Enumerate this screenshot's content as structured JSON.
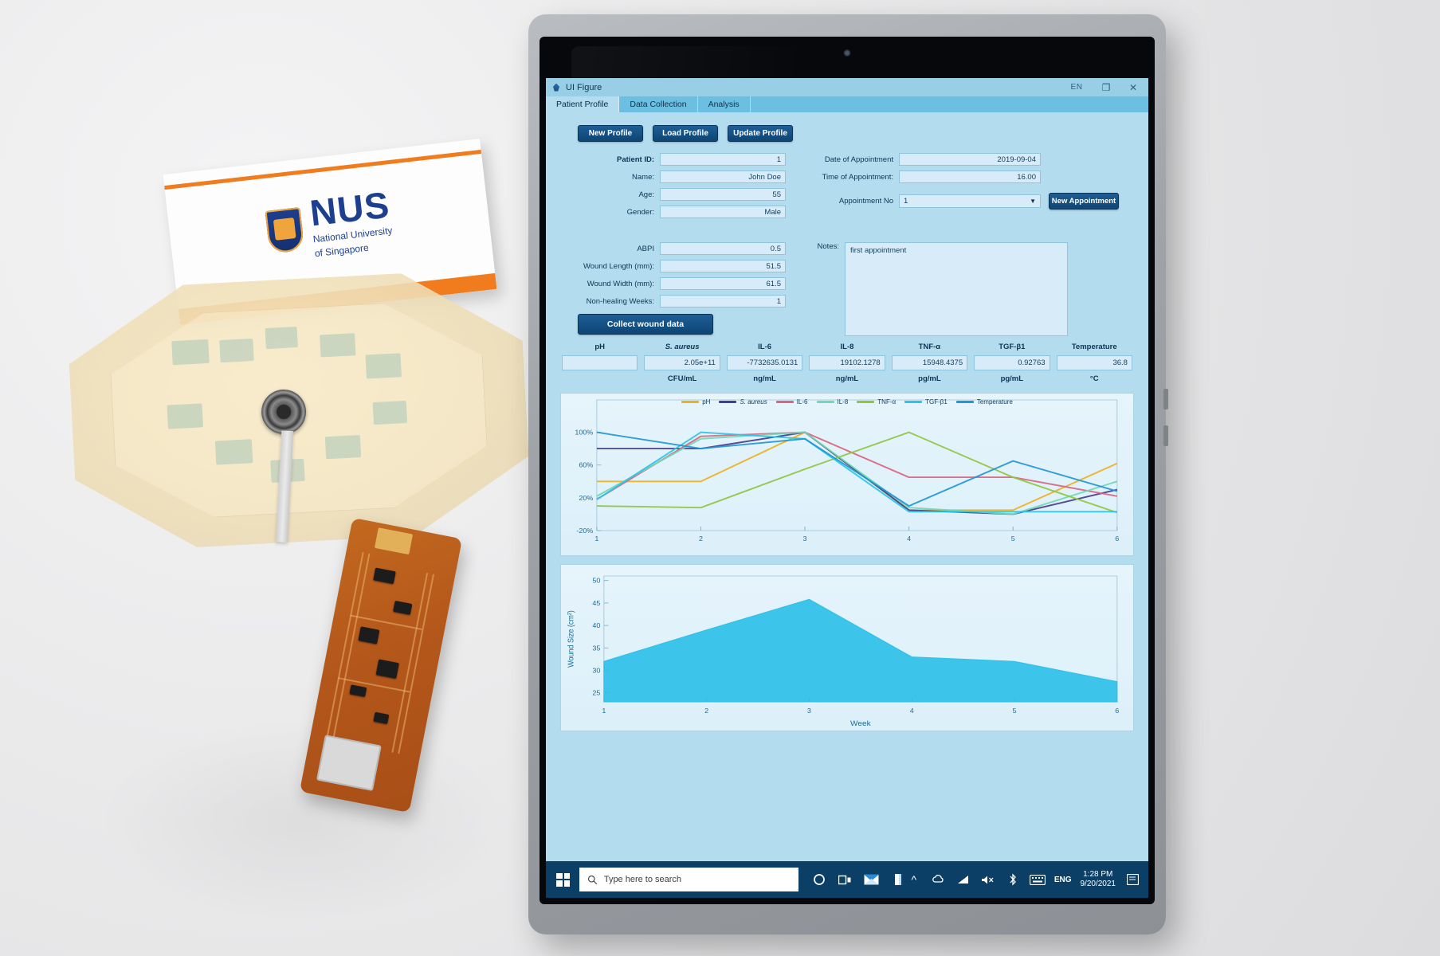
{
  "scene": {
    "business_card": {
      "brand": "NUS",
      "line1": "National University",
      "line2": "of Singapore"
    }
  },
  "window": {
    "title": "UI Figure",
    "title_icon": "matlab-figure-icon",
    "lang_indicator": "EN",
    "controls": {
      "maximize": "❐",
      "close": "✕",
      "lang_caret": "↕"
    },
    "tabs": [
      {
        "label": "Patient Profile",
        "active": true
      },
      {
        "label": "Data Collection",
        "active": false
      },
      {
        "label": "Analysis",
        "active": false
      }
    ]
  },
  "toolbar": {
    "new_profile": "New Profile",
    "load_profile": "Load Profile",
    "update_profile": "Update Profile",
    "new_appointment": "New Appointment",
    "collect_wound_data": "Collect wound data"
  },
  "profile_form": {
    "left": [
      {
        "label": "Patient ID:",
        "value": "1",
        "bold": true
      },
      {
        "label": "Name:",
        "value": "John Doe",
        "bold": false
      },
      {
        "label": "Age:",
        "value": "55",
        "bold": false
      },
      {
        "label": "Gender:",
        "value": "Male",
        "bold": false
      }
    ],
    "right": [
      {
        "label": "Date of Appointment",
        "value": "2019-09-04"
      },
      {
        "label": "Time of Appointment:",
        "value": "16.00"
      }
    ],
    "appointment_no": {
      "label": "Appointment No",
      "value": "1"
    },
    "wound": [
      {
        "label": "ABPI",
        "value": "0.5"
      },
      {
        "label": "Wound Length (mm):",
        "value": "51.5"
      },
      {
        "label": "Wound Width (mm):",
        "value": "61.5"
      },
      {
        "label": "Non-healing Weeks:",
        "value": "1"
      }
    ],
    "notes": {
      "label": "Notes:",
      "value": "first appointment"
    }
  },
  "biomarkers": [
    {
      "name": "pH",
      "italic": false,
      "value": "",
      "unit": ""
    },
    {
      "name": "S. aureus",
      "italic": true,
      "value": "2.05e+11",
      "unit": "CFU/mL"
    },
    {
      "name": "IL-6",
      "italic": false,
      "value": "-7732635.0131",
      "unit": "ng/mL"
    },
    {
      "name": "IL-8",
      "italic": false,
      "value": "19102.1278",
      "unit": "ng/mL"
    },
    {
      "name": "TNF-α",
      "italic": false,
      "value": "15948.4375",
      "unit": "pg/mL"
    },
    {
      "name": "TGF-β1",
      "italic": false,
      "value": "0.92763",
      "unit": "pg/mL"
    },
    {
      "name": "Temperature",
      "italic": false,
      "value": "36.8",
      "unit": "°C"
    }
  ],
  "chart_data": [
    {
      "type": "line",
      "title": "",
      "xlabel": "",
      "ylabel": "",
      "x": [
        1,
        2,
        3,
        4,
        5,
        6
      ],
      "xlim": [
        1,
        6
      ],
      "ylim": [
        -20,
        120
      ],
      "yticks": [
        -20,
        20,
        60,
        100
      ],
      "yticklabels": [
        "-20%",
        "20%",
        "60%",
        "100%"
      ],
      "xticklabels": [
        "1",
        "2",
        "3",
        "4",
        "5",
        "6"
      ],
      "grid": false,
      "legend_position": "top-center",
      "series": [
        {
          "name": "pH",
          "color": "#edb120",
          "values": [
            40,
            40,
            100,
            5,
            5,
            62
          ]
        },
        {
          "name": "S. aureus",
          "color": "#483d8b",
          "values": [
            80,
            80,
            100,
            5,
            0,
            30
          ]
        },
        {
          "name": "IL-6",
          "color": "#d9657f",
          "values": [
            18,
            95,
            100,
            45,
            45,
            22
          ]
        },
        {
          "name": "IL-8",
          "color": "#6fd8b4",
          "values": [
            22,
            92,
            100,
            8,
            0,
            40
          ]
        },
        {
          "name": "TNF-α",
          "color": "#8ec641",
          "values": [
            10,
            8,
            55,
            100,
            45,
            2
          ]
        },
        {
          "name": "TGF-β1",
          "color": "#29c5e8",
          "values": [
            18,
            100,
            92,
            3,
            3,
            3
          ]
        },
        {
          "name": "Temperature",
          "color": "#2196d4",
          "values": [
            100,
            80,
            92,
            10,
            65,
            28
          ]
        }
      ]
    },
    {
      "type": "area",
      "title": "",
      "xlabel": "Week",
      "ylabel": "Wound Size (cm²)",
      "x": [
        1,
        2,
        3,
        4,
        5,
        6
      ],
      "values": [
        32.0,
        39.0,
        45.8,
        33.0,
        32.0,
        27.5
      ],
      "xlim": [
        1,
        6
      ],
      "ylim": [
        23,
        51
      ],
      "yticks": [
        25,
        30,
        35,
        40,
        45,
        50
      ],
      "yticklabels": [
        "25",
        "30",
        "35",
        "40",
        "45",
        "50"
      ],
      "xticklabels": [
        "1",
        "2",
        "3",
        "4",
        "5",
        "6"
      ],
      "fill_color": "#2ec0e8",
      "grid": false
    }
  ],
  "taskbar": {
    "search_placeholder": "Type here to search",
    "icons": [
      "cortana-icon",
      "task-view-icon",
      "mail-icon",
      "onenote-icon",
      "show-hidden-icons-icon",
      "onedrive-icon",
      "network-icon",
      "volume-muted-icon",
      "bluetooth-icon",
      "keyboard-icon"
    ],
    "language": "ENG",
    "time": "1:28 PM",
    "date": "9/20/2021",
    "action_center": "action-center-icon"
  }
}
